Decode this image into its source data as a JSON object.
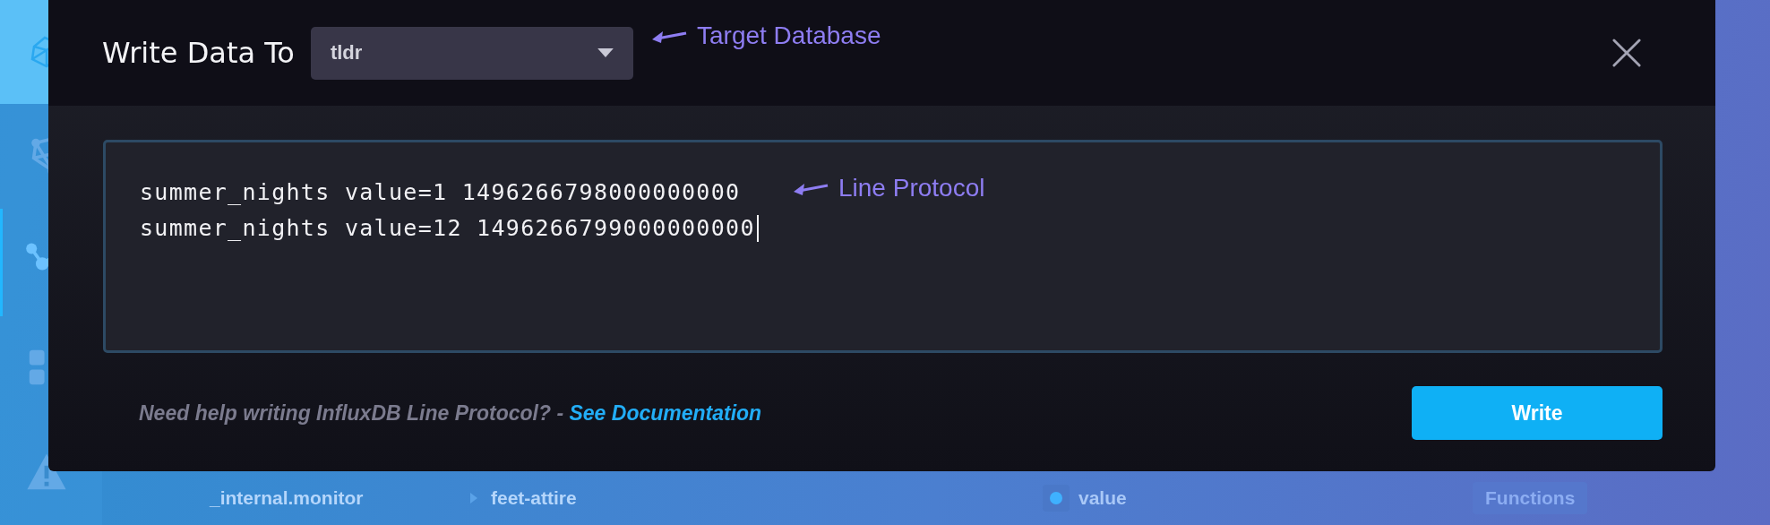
{
  "sidebar": {
    "items": [
      {
        "kind": "network",
        "selected": false
      },
      {
        "kind": "share",
        "selected": true
      },
      {
        "kind": "grid",
        "selected": false
      },
      {
        "kind": "warning",
        "selected": false
      }
    ]
  },
  "background_row": {
    "database": "_internal.monitor",
    "measurement": "feet-attire",
    "field": "value",
    "functions_button": "Functions"
  },
  "modal": {
    "title": "Write Data To",
    "database_select": {
      "value": "tldr"
    },
    "editor": {
      "lines": [
        "summer_nights value=1 1496266798000000000",
        "summer_nights value=12 1496266799000000000"
      ]
    },
    "help_text": "Need help writing InfluxDB Line Protocol? - ",
    "help_link": "See Documentation",
    "write_button": "Write"
  },
  "annotations": [
    {
      "kind": "database",
      "text": "Target Database"
    },
    {
      "kind": "editor",
      "text": "Line Protocol"
    }
  ]
}
